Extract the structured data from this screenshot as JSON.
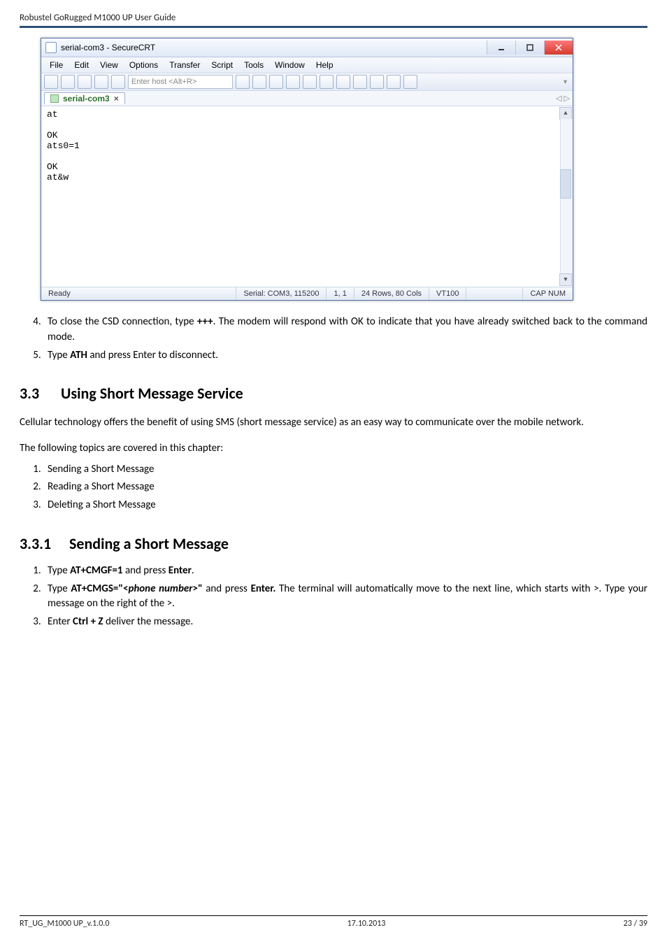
{
  "header": {
    "text": "Robustel GoRugged M1000 UP User Guide"
  },
  "window": {
    "title": "serial-com3 - SecureCRT",
    "menus": [
      "File",
      "Edit",
      "View",
      "Options",
      "Transfer",
      "Script",
      "Tools",
      "Window",
      "Help"
    ],
    "host_placeholder": "Enter host <Alt+R>",
    "tab": {
      "label": "serial-com3",
      "close": "×"
    },
    "tab_nav": "◁  ▷",
    "toolbar_triangles": "▾",
    "terminal": "at\n\nOK\nats0=1\n\nOK\nat&w",
    "scroll": {
      "up": "▲",
      "down": "▼"
    },
    "status": {
      "ready": "Ready",
      "port": "Serial: COM3, 115200",
      "cursor": "1,  1",
      "size": "24 Rows, 80 Cols",
      "emul": "VT100",
      "caps": "CAP  NUM"
    }
  },
  "steps_a": {
    "s4_a": "To close the CSD connection, type ",
    "s4_cmd": "+++",
    "s4_b": ". The modem will respond with OK to indicate that you have already switched back to the command mode.",
    "s5_a": "Type ",
    "s5_cmd": "ATH",
    "s5_b": " and press Enter to disconnect."
  },
  "sec33": {
    "num": "3.3",
    "title": "Using Short Message Service",
    "intro": "Cellular technology offers the benefit of using SMS (short message service) as an easy way to communicate over the mobile network.",
    "topics_lead": "The following topics are covered in this chapter:",
    "t1": "Sending a Short Message",
    "t2": "Reading a Short Message",
    "t3": "Deleting a Short Message"
  },
  "sec331": {
    "num": "3.3.1",
    "title": "Sending a Short Message",
    "s1_a": "Type ",
    "s1_cmd": "AT+CMGF=1",
    "s1_b": " and press ",
    "s1_enter": "Enter",
    "s1_c": ".",
    "s2_a": "Type ",
    "s2_cmd_a": "AT+CMGS=\"<",
    "s2_cmd_ph": "phone number",
    "s2_cmd_b": ">\"",
    "s2_b": " and press ",
    "s2_enter": "Enter.",
    "s2_c": " The terminal will automatically move to the next line, which starts with >. Type your message on the right of the >.",
    "s3_a": "Enter ",
    "s3_cmd": "Ctrl + Z",
    "s3_b": " deliver the message."
  },
  "footer": {
    "left": "RT_UG_M1000 UP_v.1.0.0",
    "mid": "17.10.2013",
    "right": "23 / 39"
  }
}
